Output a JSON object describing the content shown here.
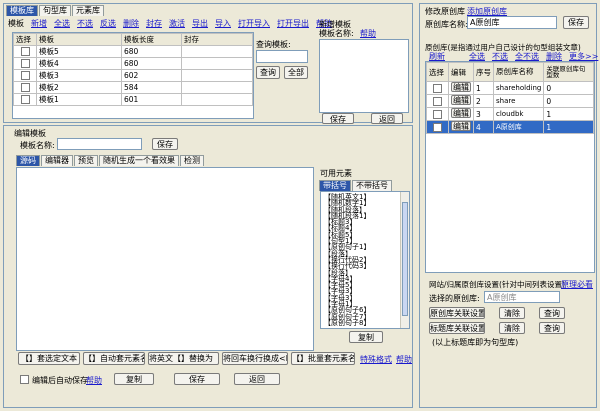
{
  "left_top": {
    "tabs": [
      "模板库",
      "句型库",
      "元素库"
    ],
    "toolbar": {
      "label": "模板",
      "links": [
        "新增",
        "全选",
        "不选",
        "反选",
        "删除",
        "封存",
        "激活",
        "导出",
        "导入",
        "打开导入",
        "打开导出",
        "帮助"
      ]
    },
    "table": {
      "headers": [
        "选择",
        "模板",
        "模板长度",
        "封存"
      ],
      "rows": [
        {
          "name": "模板5",
          "length": "680",
          "sealed": ""
        },
        {
          "name": "模板4",
          "length": "680",
          "sealed": ""
        },
        {
          "name": "模板3",
          "length": "602",
          "sealed": ""
        },
        {
          "name": "模板2",
          "length": "584",
          "sealed": ""
        },
        {
          "name": "模板1",
          "length": "601",
          "sealed": ""
        }
      ]
    },
    "query": {
      "label": "查询模板:",
      "query_btn": "查询",
      "all_btn": "全部"
    },
    "new_template": {
      "title": "新增模板",
      "name_label": "模板名称:",
      "help": "帮助",
      "save": "保存",
      "back": "返回"
    }
  },
  "editor": {
    "title": "编辑模板",
    "name_label": "模板名称:",
    "save": "保存",
    "tabs": [
      "源码",
      "编辑器",
      "预览",
      "随机生成一个看效果",
      "检测"
    ],
    "elements": {
      "title": "可用元素",
      "tabs": [
        "带括号",
        "不带括号"
      ],
      "items": [
        "【随机英文1】",
        "【随机数字1】",
        "【随机段落】",
        "【随机段落1】",
        "【标题3】",
        "【标题4】",
        "【标题5】",
        "【句型1】",
        "【原创句子1】",
        "【段落】",
        "【换行代码2】",
        "【换行代码3】",
        "【段落】",
        "【字母4】",
        "【字母5】",
        "【字母3】",
        "【字母3】",
        "【字母1】",
        "【原创句子6】",
        "【原创句子7】",
        "【原创句子8】"
      ],
      "copy": "复制"
    },
    "bottom_buttons": [
      "【】套选定文本",
      "【】自动套元素名",
      "将英文【】替换为【】",
      "将回车换行换成<br>",
      "【】批量套元素名"
    ],
    "special_format": "特殊格式",
    "help": "帮助",
    "auto_save_label": "编辑后自动保存",
    "auto_help": "帮助",
    "footer_buttons": {
      "copy": "复制",
      "save": "保存",
      "back": "返回"
    }
  },
  "right": {
    "edit_title": "修改原创库",
    "edit_link": "添加原创库",
    "name_label": "原创库名称:",
    "name_value": "A原创库",
    "save": "保存",
    "section_title": "原创库(是指通过用户自己设计的句型组装文章)",
    "links": [
      "刷新",
      "全选",
      "不选",
      "全不选",
      "删除",
      "更多>>"
    ],
    "table": {
      "headers": [
        "选择",
        "编辑",
        "序号",
        "原创库名称",
        "关联原创库句型数"
      ],
      "rows": [
        {
          "edit": "编辑",
          "no": "1",
          "name": "shareholding",
          "count": "0",
          "selected": false
        },
        {
          "edit": "编辑",
          "no": "2",
          "name": "share",
          "count": "0",
          "selected": false
        },
        {
          "edit": "编辑",
          "no": "3",
          "name": "cloudbk",
          "count": "1",
          "selected": false
        },
        {
          "edit": "编辑",
          "no": "4",
          "name": "A原创库",
          "count": "1",
          "selected": true
        }
      ]
    },
    "assoc": {
      "title": "网站/归属原创库设置(针对中间列表设置)",
      "title_link": "原理必看",
      "selected_label": "选择的原创库:",
      "selected_value": "A原创库",
      "row1_btn": "原创库关联设置",
      "row2_btn": "标题库关联设置",
      "clear": "清除",
      "query": "查询",
      "note": "(以上标题库即为句型库)"
    }
  }
}
